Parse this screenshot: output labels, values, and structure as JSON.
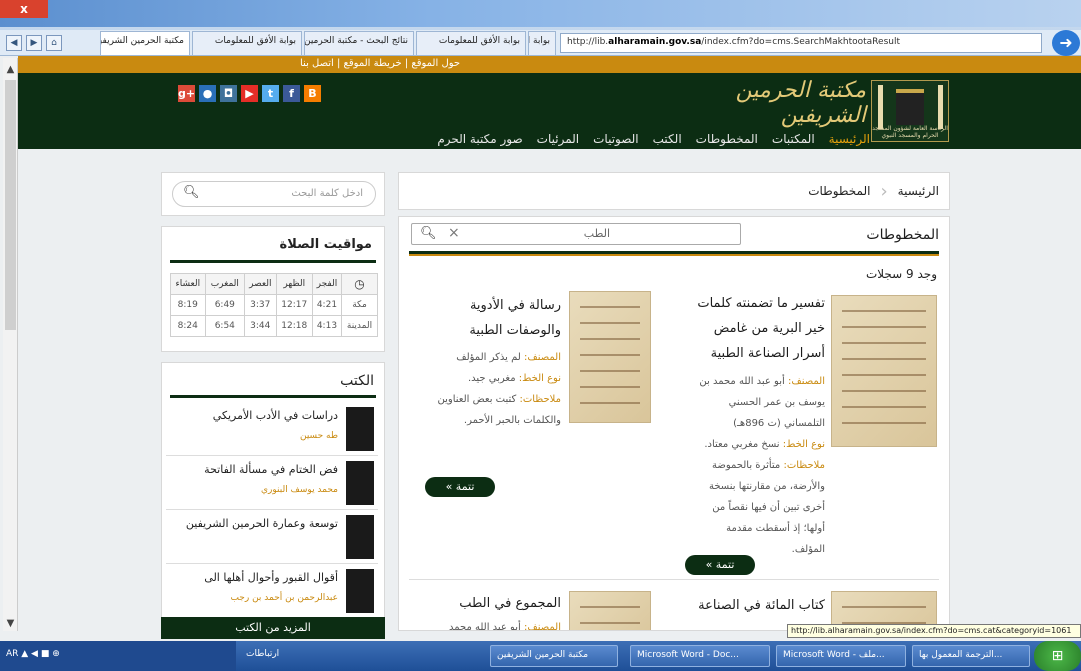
{
  "browser": {
    "close_label": "x",
    "tabs": [
      {
        "label": "مكتبة الحرمين الشريفين",
        "active": true
      },
      {
        "label": "بوابة الأفق للمعلومات"
      },
      {
        "label": "نتائج البحث - مكتبة الحرمين"
      },
      {
        "label": "بوابة الأفق للمعلومات"
      },
      {
        "label": "بوابة الأفق للمعلومات"
      }
    ],
    "address_prefix": "http://lib.",
    "address_domain": "alharamain.gov.sa",
    "address_rest": "/index.cfm?do=cms.SearchMakhtootaResult"
  },
  "site": {
    "topbar_links": "حول الموقع | خريطة الموقع | اتصل بنا",
    "logo_text": "مكتبة الحرمين الشريفين",
    "logo_caption": "الرئاسة العامة لشؤون المسجد الحرام والمسجد النبوي",
    "social": [
      {
        "icon": "blogger-icon",
        "glyph": "B",
        "color": "#f57d00"
      },
      {
        "icon": "facebook-icon",
        "glyph": "f",
        "color": "#3b5998"
      },
      {
        "icon": "twitter-icon",
        "glyph": "t",
        "color": "#55acee"
      },
      {
        "icon": "youtube-icon",
        "glyph": "▶",
        "color": "#e52d27"
      },
      {
        "icon": "instagram-icon",
        "glyph": "◘",
        "color": "#3f729b"
      },
      {
        "icon": "flickr-icon",
        "glyph": "●",
        "color": "#2a6fb8"
      },
      {
        "icon": "googleplus-icon",
        "glyph": "g+",
        "color": "#dd4b39"
      }
    ],
    "nav": [
      "الرئيسية",
      "المكتبات",
      "المخطوطات",
      "الكتب",
      "الصوتيات",
      "المرئيات",
      "صور مكتبة الحرم"
    ]
  },
  "breadcrumb": {
    "home": "الرئيسية",
    "current": "المخطوطات"
  },
  "main": {
    "title": "المخطوطات",
    "filter_value": "الطب",
    "count": "وجد 9 سجلات",
    "more_label": "تتمة",
    "results": [
      {
        "title_lines": [
          "تفسير ما تضمنته كلمات",
          "خير البرية من غامض",
          "أسرار الصناعة الطبية"
        ],
        "meta": [
          {
            "k": "المصنف:",
            "v": " أبو عبد الله محمد بن"
          },
          {
            "k": "",
            "v": "يوسف بن عمر الحسني"
          },
          {
            "k": "",
            "v": "التلمساني (ت 896هـ)"
          },
          {
            "k": "نوع الخط:",
            "v": " نسخ مغربي معتاد."
          },
          {
            "k": "ملاحظات:",
            "v": " متأثرة بالحموضة"
          },
          {
            "k": "",
            "v": "والأرضة، من مقارنتها بنسخة"
          },
          {
            "k": "",
            "v": "أخرى تبين أن فيها نقصاً من"
          },
          {
            "k": "",
            "v": "أولها؛ إذ أسقطت مقدمة"
          },
          {
            "k": "",
            "v": "المؤلف."
          }
        ]
      },
      {
        "title_lines": [
          "رسالة في الأدوية",
          "والوصفات الطبية"
        ],
        "meta": [
          {
            "k": "المصنف:",
            "v": " لم يذكر المؤلف"
          },
          {
            "k": "نوع الخط:",
            "v": " مغربي جيد."
          },
          {
            "k": "ملاحظات:",
            "v": " كتبت بعض العناوين"
          },
          {
            "k": "",
            "v": "والكلمات بالحبر الأحمر."
          }
        ]
      },
      {
        "title_lines": [
          "كتاب المائة في الصناعة"
        ],
        "meta": []
      },
      {
        "title_lines": [
          "المجموع في الطب"
        ],
        "meta": [
          {
            "k": "المصنف:",
            "v": " أبو عبد الله محمد"
          }
        ]
      }
    ]
  },
  "sidebar": {
    "search_placeholder": "ادخل كلمة البحث",
    "prayer_title": "مواقيت الصلاة",
    "prayer_headers": [
      "الفجر",
      "الظهر",
      "العصر",
      "المغرب",
      "العشاء"
    ],
    "prayer_rows": [
      {
        "city": "مكة",
        "times": [
          "4:21",
          "12:17",
          "3:37",
          "6:49",
          "8:19"
        ]
      },
      {
        "city": "المدينة",
        "times": [
          "4:13",
          "12:18",
          "3:44",
          "6:54",
          "8:24"
        ]
      }
    ],
    "books_title": "الكتب",
    "books": [
      {
        "title": "دراسات في الأدب الأمريكي",
        "author": "طه حسين"
      },
      {
        "title": "فض الختام في مسألة الفاتحة",
        "author": "محمد يوسف البنوري"
      },
      {
        "title": "توسعة وعمارة الحرمين الشريفين",
        "author": ""
      },
      {
        "title": "أقوال القبور وأحوال أهلها الى",
        "author": "عبدالرحمن بن أحمد بن رجب"
      }
    ],
    "more_books": "المزيد من الكتب"
  },
  "status": {
    "tooltip": "http://lib.alharamain.gov.sa/index.cfm?do=cms.cat&categoryid=1061"
  },
  "taskbar": {
    "tray": "AR  ▲  ◀  ■  ⊕",
    "items": [
      "ارتباطات",
      "مكتبة الحرمين الشريفين",
      "Microsoft Word - Doc...",
      "Microsoft Word - ملف...",
      "الترجمة المعمول بها..."
    ]
  }
}
